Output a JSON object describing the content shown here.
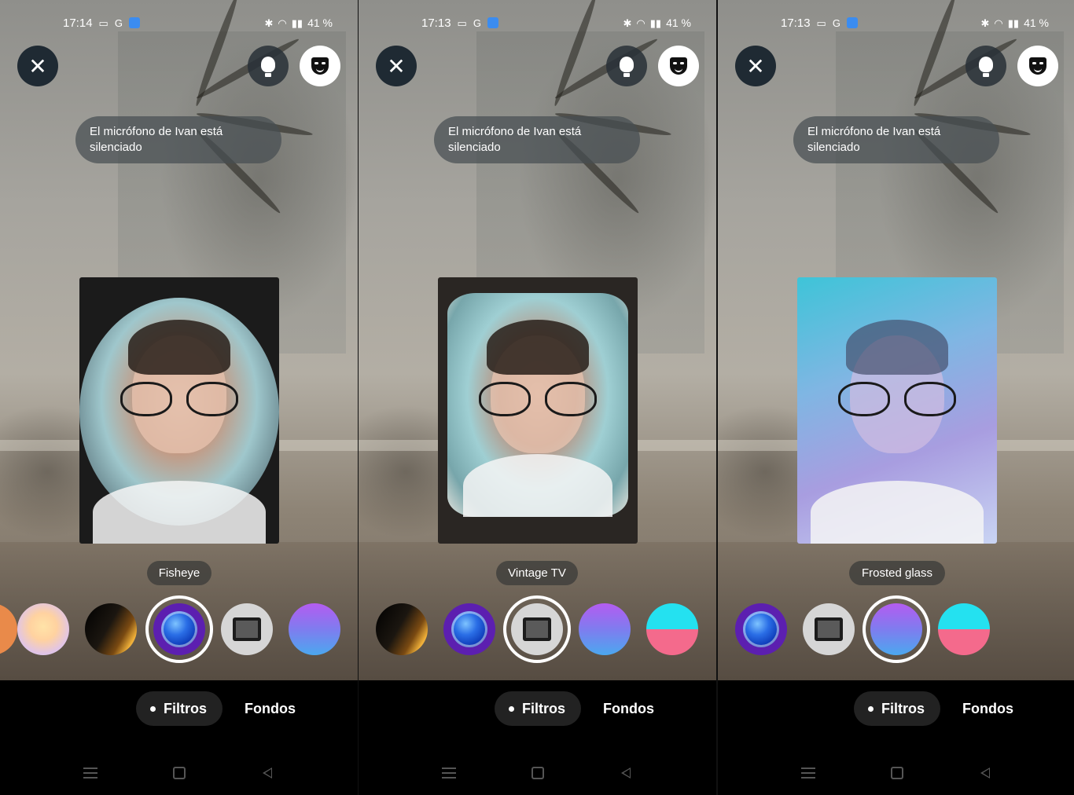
{
  "screens": [
    {
      "status": {
        "time": "17:14",
        "battery": "41 %"
      },
      "toast": "El micrófono de Ivan está silenciado",
      "filter_name": "Fisheye",
      "tabs": {
        "filters": "Filtros",
        "backgrounds": "Fondos"
      }
    },
    {
      "status": {
        "time": "17:13",
        "battery": "41 %"
      },
      "toast": "El micrófono de Ivan está silenciado",
      "filter_name": "Vintage TV",
      "tabs": {
        "filters": "Filtros",
        "backgrounds": "Fondos"
      }
    },
    {
      "status": {
        "time": "17:13",
        "battery": "41 %"
      },
      "toast": "El micrófono de Ivan está silenciado",
      "filter_name": "Frosted glass",
      "tabs": {
        "filters": "Filtros",
        "backgrounds": "Fondos"
      }
    }
  ],
  "icons": {
    "close": "close-icon",
    "light": "lightbulb-icon",
    "effects": "mask-icon",
    "nav": [
      "menu-icon",
      "home-icon",
      "back-icon"
    ]
  },
  "colors": {
    "filter_fisheye": "#5c1fb0",
    "filter_frosted": "#7f7cef",
    "filter_split_top": "#24e1f0",
    "filter_split_bottom": "#f46a8c",
    "tab_pill": "#222222"
  }
}
